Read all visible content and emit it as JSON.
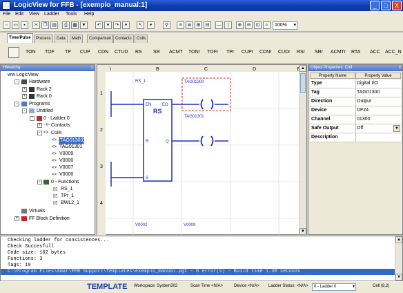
{
  "window": {
    "title": "LogicView for FFB - [exemplo_manual:1]",
    "min": "_",
    "max": "□",
    "close": "X"
  },
  "menu": [
    "File",
    "Edit",
    "View",
    "Ladder",
    "Tools",
    "Help"
  ],
  "toolbar": {
    "zoom_value": "100%"
  },
  "palette_tabs": [
    "Time/Pulse",
    "Process",
    "Data",
    "Math",
    "Comparison",
    "Contacts",
    "Coils"
  ],
  "elements": [
    "TON",
    "TOF",
    "TP",
    "CUP",
    "CDN",
    "CTUD",
    "RS",
    "SR",
    "ACMT",
    "TONr",
    "TOFr",
    "TPr",
    "CUPr",
    "CDNr",
    "CUDr",
    "RSr",
    "SRr",
    "ACMTr",
    "RTA",
    "ACC",
    "ACC_N"
  ],
  "hierarchy": {
    "title": "Hierarchy",
    "root": "LogicView",
    "hardware": "Hardware",
    "racks": [
      "Rack 2",
      "Rack 0"
    ],
    "programs": "Programs",
    "untitled": "Untitled",
    "ladder": "0 - Ladder 0",
    "contacts": "Contacts",
    "coils": "Coils",
    "coil_items": [
      "TAG01300",
      "TAG01301",
      "V0009",
      "V0000",
      "V0007",
      "V0000"
    ],
    "functions": "0 - Functions",
    "function_items": [
      "RS_1",
      "TPr_1",
      "BWL2_1"
    ],
    "virtuals": "Virtuals",
    "ffblock": "FF Block Definition"
  },
  "ladder": {
    "columns": [
      "A",
      "B",
      "C",
      "D"
    ],
    "rows": [
      "1",
      "2",
      "3",
      "4"
    ],
    "block_instance": "RS_1",
    "block_name": "RS",
    "pins": {
      "en": "EN",
      "eo": "EO",
      "r": "R",
      "q": "Q",
      "s": "S"
    },
    "coil_tags": [
      "TAG01300",
      "TAG01301"
    ],
    "bottom_tags": [
      "V0002",
      "V0009"
    ]
  },
  "properties": {
    "title": "Object Properties: Coil",
    "col_name": "Property Name",
    "col_value": "Property Value",
    "rows": [
      {
        "name": "Type",
        "value": "Digital I/O"
      },
      {
        "name": "Tag",
        "value": "TAG01300"
      },
      {
        "name": "Direction",
        "value": "Output"
      },
      {
        "name": "Device",
        "value": "DF24"
      },
      {
        "name": "Channel",
        "value": "01300"
      },
      {
        "name": "Safe Output",
        "value": "Off"
      },
      {
        "name": "Description",
        "value": ""
      }
    ]
  },
  "output": {
    "lines": [
      "Checking ladder for consistences...",
      "Check Succesfull",
      "Code size: 162 bytes",
      "Functions: 3",
      "Tags: 19"
    ],
    "build_line": "C:\\Program Files\\Smar\\FFB Support\\Templates\\exemplo_manual.pgt - 0 error(s) - Build time 1.30 seconds"
  },
  "status": {
    "template": "TEMPLATE",
    "workspace": "Workspace: System302",
    "scan": "Scan Time <N/A>",
    "device": "Device <N/A>",
    "ladder_status": "Ladder Status: <N/A>",
    "ladder_sel": "0 - Ladder 0",
    "cell": "Cell (8,2)"
  },
  "colors": {
    "title_blue": "#0b3aa8",
    "ladder_blue": "#1a2fc2",
    "selection_red": "#e02020",
    "status_text": "#1d3fa0"
  }
}
